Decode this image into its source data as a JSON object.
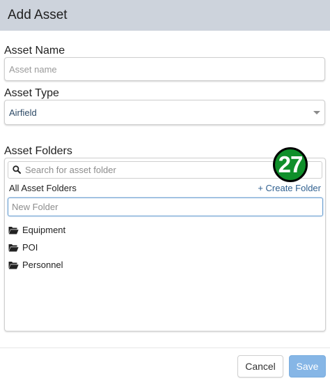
{
  "dialog": {
    "title": "Add Asset"
  },
  "form": {
    "asset_name": {
      "label": "Asset Name",
      "placeholder": "Asset name",
      "value": ""
    },
    "asset_type": {
      "label": "Asset Type",
      "selected": "Airfield"
    },
    "asset_folders": {
      "label": "Asset Folders",
      "search_placeholder": "Search for asset folder",
      "all_folders_label": "All Asset Folders",
      "create_folder_label": "+ Create Folder",
      "new_folder_placeholder": "New Folder",
      "folders": [
        {
          "label": "Equipment",
          "icon": "folder-open-icon"
        },
        {
          "label": "POI",
          "icon": "folder-open-icon"
        },
        {
          "label": "Personnel",
          "icon": "folder-open-icon"
        }
      ]
    }
  },
  "annotation": {
    "step_number": "27",
    "color": "#0f8f2a"
  },
  "footer": {
    "cancel_label": "Cancel",
    "save_label": "Save"
  },
  "colors": {
    "header_bg": "#cdd3dc",
    "link": "#2f5f8f",
    "save_button": "#86b6e6",
    "focus_border": "#6a9fd1"
  }
}
